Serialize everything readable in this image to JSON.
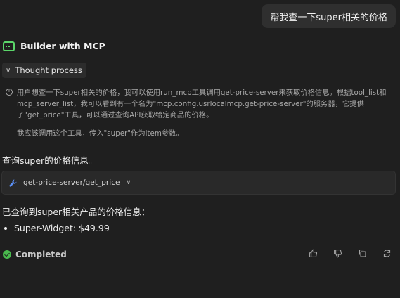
{
  "user_message": "帮我查一下super相关的价格",
  "assistant": {
    "name": "Builder with MCP",
    "accent_color": "#5bd66a"
  },
  "thought": {
    "toggle_label": "Thought process",
    "line1": "用户想查一下super相关的价格，我可以使用run_mcp工具调用get-price-server来获取价格信息。根据tool_list和",
    "line2": "mcp_server_list，我可以看到有一个名为\"mcp.config.usrlocalmcp.get-price-server\"的服务器，它提供",
    "line3": "了\"get_price\"工具，可以通过查询API获取给定商品的价格。",
    "line4": "我应该调用这个工具，传入\"super\"作为item参数。"
  },
  "reply_text": "查询super的价格信息。",
  "tool_call": {
    "label": "get-price-server/get_price",
    "icon": "wrench-icon"
  },
  "result": {
    "heading": "已查询到super相关产品的价格信息：",
    "items": [
      "Super-Widget: $49.99"
    ]
  },
  "status": {
    "label": "Completed",
    "color": "#49b84d"
  },
  "actions": [
    "thumbs-up-icon",
    "thumbs-down-icon",
    "copy-icon",
    "refresh-icon"
  ]
}
